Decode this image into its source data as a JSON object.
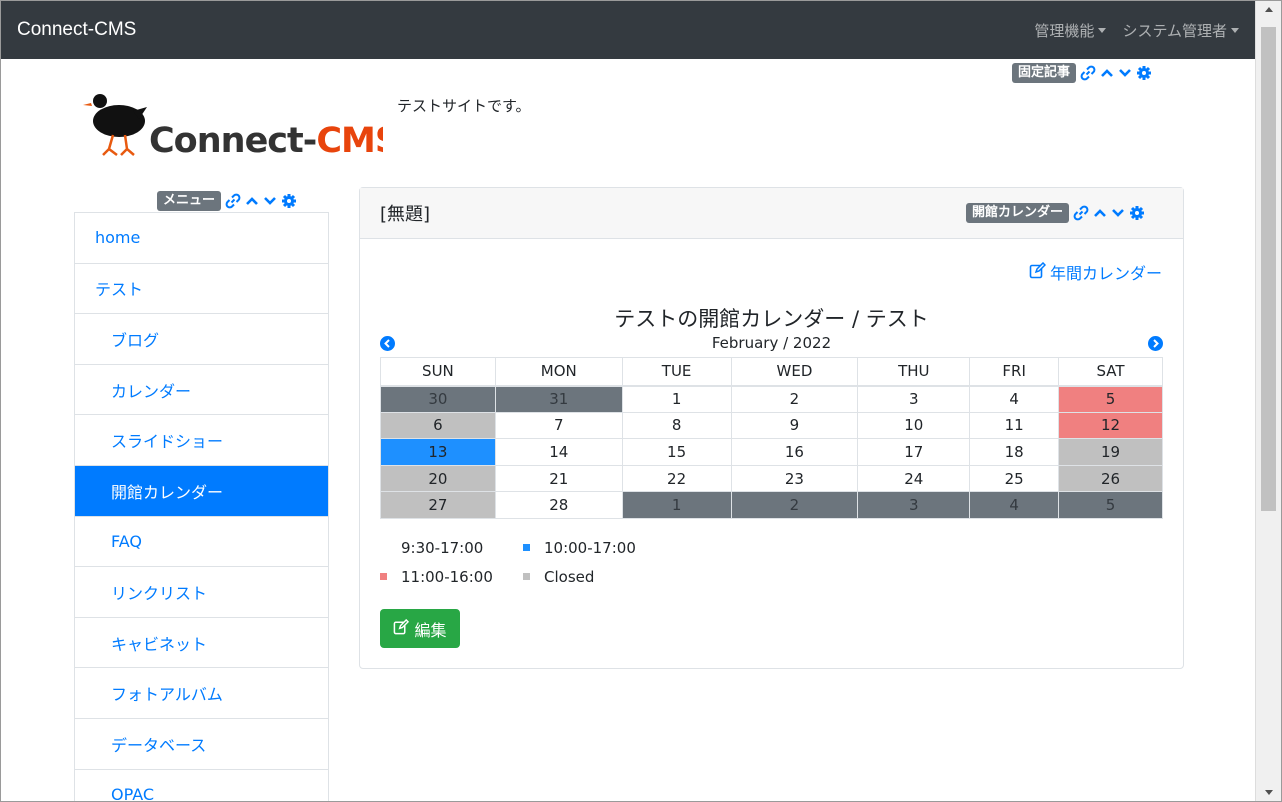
{
  "navbar": {
    "brand": "Connect-CMS",
    "admin_menu": "管理機能",
    "user_menu": "システム管理者"
  },
  "header": {
    "fixed_article_badge": "固定記事",
    "site_description": "テストサイトです。",
    "logo_text": "Connect-CMS"
  },
  "menu": {
    "badge": "メニュー",
    "items": [
      {
        "label": "home"
      },
      {
        "label": "テスト"
      },
      {
        "label": "ブログ"
      },
      {
        "label": "カレンダー"
      },
      {
        "label": "スライドショー"
      },
      {
        "label": "開館カレンダー"
      },
      {
        "label": "FAQ"
      },
      {
        "label": "リンクリスト"
      },
      {
        "label": "キャビネット"
      },
      {
        "label": "フォトアルバム"
      },
      {
        "label": "データベース"
      },
      {
        "label": "OPAC"
      }
    ]
  },
  "frame": {
    "title": "[無題]",
    "badge": "開館カレンダー",
    "year_link": "年間カレンダー",
    "edit_label": "編集"
  },
  "calendar": {
    "title": "テストの開館カレンダー / テスト",
    "month": "February / 2022",
    "weekdays": [
      "SUN",
      "MON",
      "TUE",
      "WED",
      "THU",
      "FRI",
      "SAT"
    ],
    "weeks": [
      [
        {
          "d": "30",
          "c": "out"
        },
        {
          "d": "31",
          "c": "out"
        },
        {
          "d": "1",
          "c": "none"
        },
        {
          "d": "2",
          "c": "none"
        },
        {
          "d": "3",
          "c": "none"
        },
        {
          "d": "4",
          "c": "none"
        },
        {
          "d": "5",
          "c": "red"
        }
      ],
      [
        {
          "d": "6",
          "c": "closed"
        },
        {
          "d": "7",
          "c": "none"
        },
        {
          "d": "8",
          "c": "none"
        },
        {
          "d": "9",
          "c": "none"
        },
        {
          "d": "10",
          "c": "none"
        },
        {
          "d": "11",
          "c": "none"
        },
        {
          "d": "12",
          "c": "red"
        }
      ],
      [
        {
          "d": "13",
          "c": "blue"
        },
        {
          "d": "14",
          "c": "none"
        },
        {
          "d": "15",
          "c": "none"
        },
        {
          "d": "16",
          "c": "none"
        },
        {
          "d": "17",
          "c": "none"
        },
        {
          "d": "18",
          "c": "none"
        },
        {
          "d": "19",
          "c": "closed"
        }
      ],
      [
        {
          "d": "20",
          "c": "closed"
        },
        {
          "d": "21",
          "c": "none"
        },
        {
          "d": "22",
          "c": "none"
        },
        {
          "d": "23",
          "c": "none"
        },
        {
          "d": "24",
          "c": "none"
        },
        {
          "d": "25",
          "c": "none"
        },
        {
          "d": "26",
          "c": "closed"
        }
      ],
      [
        {
          "d": "27",
          "c": "closed"
        },
        {
          "d": "28",
          "c": "none"
        },
        {
          "d": "1",
          "c": "out"
        },
        {
          "d": "2",
          "c": "out"
        },
        {
          "d": "3",
          "c": "out"
        },
        {
          "d": "4",
          "c": "out"
        },
        {
          "d": "5",
          "c": "out"
        }
      ]
    ],
    "legend": [
      {
        "label": "9:30-17:00",
        "c": "none"
      },
      {
        "label": "10:00-17:00",
        "c": "blue"
      },
      {
        "label": "11:00-16:00",
        "c": "red"
      },
      {
        "label": "Closed",
        "c": "closed"
      }
    ],
    "colors": {
      "none": "#ffffff",
      "out": "#6c757d",
      "red": "#f08080",
      "closed": "#c0c0c0",
      "blue": "#1e90ff"
    }
  }
}
